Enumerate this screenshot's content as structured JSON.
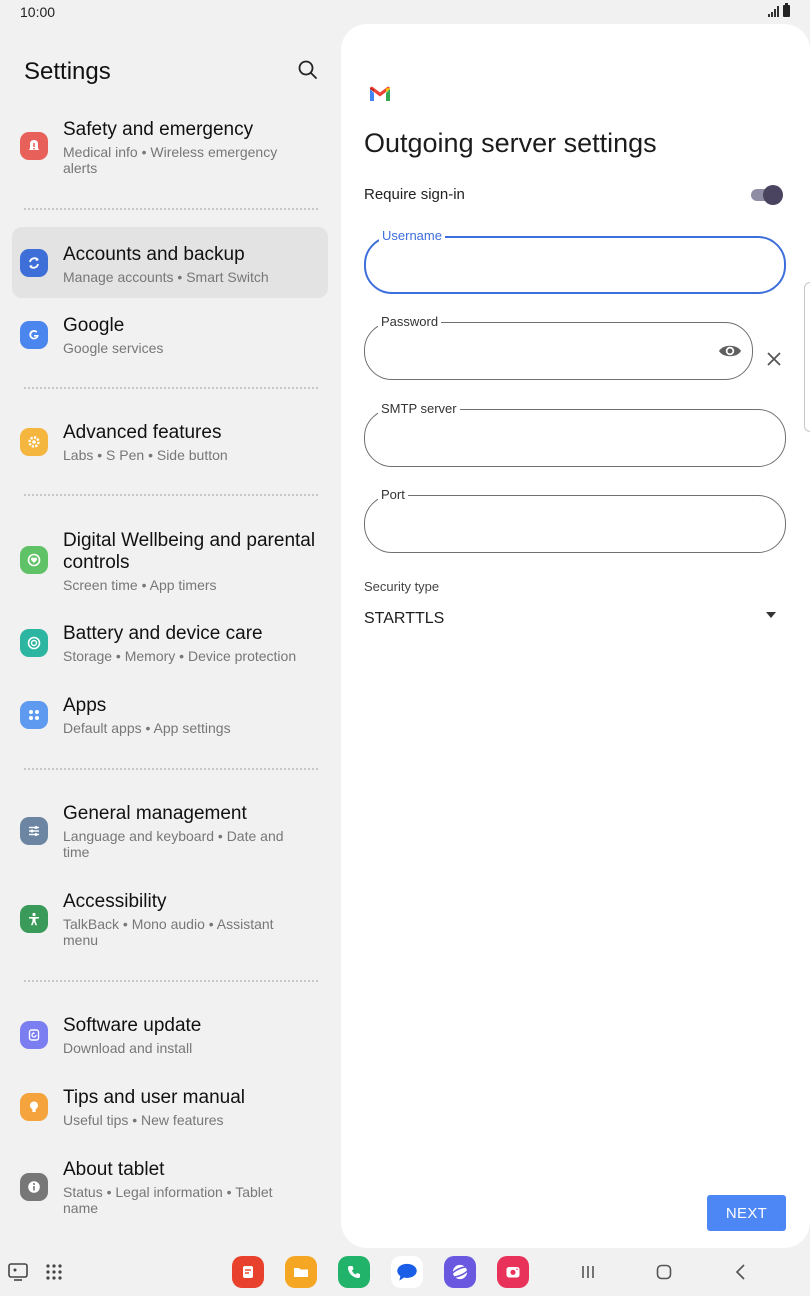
{
  "status_bar": {
    "time": "10:00"
  },
  "left": {
    "title": "Settings",
    "items": [
      {
        "title": "Safety and emergency",
        "subtitle": "Medical info  •  Wireless emergency alerts",
        "icon": "alert-icon",
        "color": "#e8605a"
      },
      {
        "title": "Accounts and backup",
        "subtitle": "Manage accounts  •  Smart Switch",
        "icon": "sync-icon",
        "color": "#3e6fd8"
      },
      {
        "title": "Google",
        "subtitle": "Google services",
        "icon": "google-icon",
        "color": "#4b86ee"
      },
      {
        "title": "Advanced features",
        "subtitle": "Labs  •  S Pen  •  Side button",
        "icon": "star-gear-icon",
        "color": "#f5b63f"
      },
      {
        "title": "Digital Wellbeing and parental controls",
        "subtitle": "Screen time  •  App timers",
        "icon": "heart-circle-icon",
        "color": "#5fc266"
      },
      {
        "title": "Battery and device care",
        "subtitle": "Storage  •  Memory  •  Device protection",
        "icon": "device-care-icon",
        "color": "#2cb5a0"
      },
      {
        "title": "Apps",
        "subtitle": "Default apps  •  App settings",
        "icon": "apps-grid-icon",
        "color": "#5e9bf0"
      },
      {
        "title": "General management",
        "subtitle": "Language and keyboard  •  Date and time",
        "icon": "sliders-icon",
        "color": "#6b85a3"
      },
      {
        "title": "Accessibility",
        "subtitle": "TalkBack  •  Mono audio  •  Assistant menu",
        "icon": "accessibility-icon",
        "color": "#3a9a59"
      },
      {
        "title": "Software update",
        "subtitle": "Download and install",
        "icon": "software-update-icon",
        "color": "#7b7ef0"
      },
      {
        "title": "Tips and user manual",
        "subtitle": "Useful tips  •  New features",
        "icon": "lightbulb-icon",
        "color": "#f5a33c"
      },
      {
        "title": "About tablet",
        "subtitle": "Status  •  Legal information  •  Tablet name",
        "icon": "info-icon",
        "color": "#777777"
      }
    ]
  },
  "right": {
    "title": "Outgoing server settings",
    "require_signin_label": "Require sign-in",
    "require_signin_on": true,
    "fields": {
      "username": {
        "label": "Username",
        "value": ""
      },
      "password": {
        "label": "Password",
        "value": ""
      },
      "smtp": {
        "label": "SMTP server",
        "value": ""
      },
      "port": {
        "label": "Port",
        "value": ""
      }
    },
    "security_type_label": "Security type",
    "security_type_value": "STARTTLS",
    "next_label": "NEXT"
  },
  "colors": {
    "accent": "#3d6fdc",
    "next_button": "#4d87f5"
  }
}
